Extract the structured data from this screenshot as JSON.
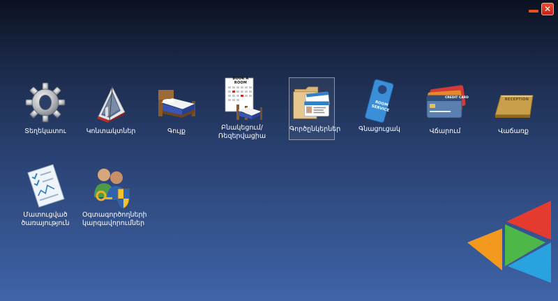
{
  "window": {
    "minimize_icon": "minimize-icon",
    "close_icon": "close-icon",
    "close_glyph": "✕"
  },
  "tiles": [
    {
      "label": "Տեղեկատու",
      "icon": "gear-icon"
    },
    {
      "label": "Կոնտակտներ",
      "icon": "contacts-book-icon"
    },
    {
      "label": "Գույք",
      "icon": "bed-icon"
    },
    {
      "label": "Բնակեցում/ Ռեզերվացիա",
      "icon": "booking-calendar-bed-icon"
    },
    {
      "label": "Գործընկերներ",
      "icon": "partners-folder-icon"
    },
    {
      "label": "Գնացուցակ",
      "icon": "room-service-tag-icon"
    },
    {
      "label": "Վճարում",
      "icon": "credit-cards-icon"
    },
    {
      "label": "Վաճառք",
      "icon": "reception-sign-icon"
    },
    {
      "label": "Մատուցված ծառայություն",
      "icon": "document-report-icon"
    },
    {
      "label": "Օգտագործողների կարգավորումներ",
      "icon": "user-settings-icon"
    }
  ],
  "booking_sign_text": "BOOK A ROOM",
  "room_service_text": [
    "ROOM",
    "SERVICE"
  ],
  "credit_card_text": "CREDIT CARD",
  "reception_text": "RECEPTION",
  "colors": {
    "accent_red": "#e53a2e",
    "accent_orange": "#f39a1e",
    "accent_green": "#4db848",
    "accent_blue": "#29a3e0"
  }
}
